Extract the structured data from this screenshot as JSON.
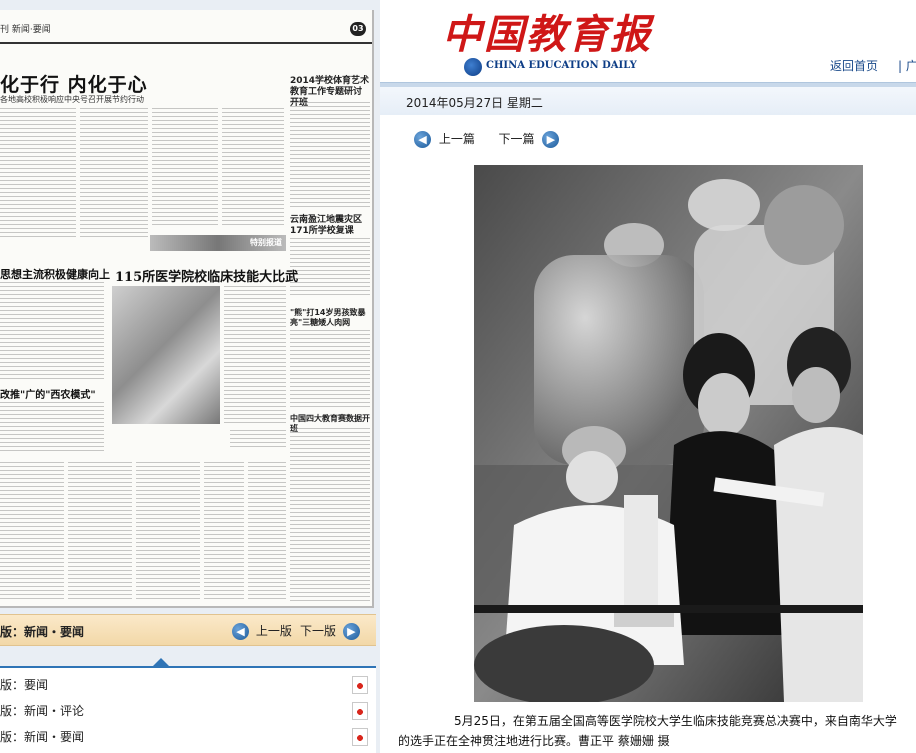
{
  "newspaper": {
    "header": "刊  新闻·要闻",
    "page_number": "03",
    "headline": "化于行  内化于心",
    "subheadline": "各地高校积极响应中央号召开展节约行动",
    "column_head_1": "思想主流积极健康向上",
    "column_head_2": "115所医学院校临床技能大比武",
    "column_head_3": "改推\"广的\"西农模式\"",
    "side_head_1": "2014学校体育艺术教育工作专题研讨开班",
    "side_head_2": "云南盈江地震灾区171所学校复课",
    "side_head_3": "\"熊\"打14岁男孩致暴亮\"三糖矮人肉网",
    "side_head_4": "中国四大教育赛数据开班",
    "banner_text": "特别报道"
  },
  "edition_nav": {
    "current_label": "版：新闻・要闻",
    "prev_label": "上一版",
    "next_label": "下一版",
    "editions": [
      {
        "label": "版：要闻"
      },
      {
        "label": "版：新闻・评论"
      },
      {
        "label": "版：新闻・要闻"
      }
    ]
  },
  "site": {
    "title": "中国教育报",
    "subtitle": "CHINA EDUCATION DAILY",
    "home_link": "返回首页",
    "ad_link": "广告",
    "separator": "|",
    "date": "2014年05月27日  星期二"
  },
  "article_nav": {
    "prev_label": "上一篇",
    "next_label": "下一篇"
  },
  "caption": "5月25日，在第五届全国高等医学院校大学生临床技能竞赛总决赛中，来自南华大学的选手正在全神贯注地进行比赛。曹正平  蔡姗姗  摄",
  "icons": {
    "prev": "arrow-left-icon",
    "next": "arrow-right-icon",
    "pdf": "pdf-icon"
  },
  "colors": {
    "masthead_red": "#cf1717",
    "link_blue": "#1a4a8a",
    "nav_gold": "#f2d8a8"
  }
}
